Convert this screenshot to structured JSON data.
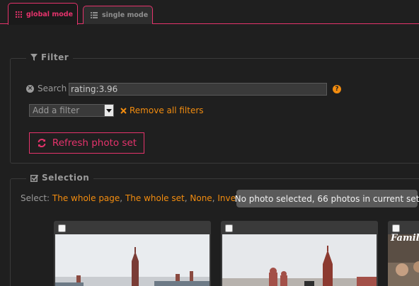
{
  "tabs": [
    {
      "label": "global mode",
      "icon": "grid-icon",
      "active": true
    },
    {
      "label": "single mode",
      "icon": "list-icon",
      "active": false
    }
  ],
  "filter": {
    "legend": "Filter",
    "search_label": "Search",
    "search_value": "rating:3.96",
    "select_value": "Add a filter",
    "remove_all_label": "Remove all filters",
    "refresh_label": "Refresh photo set"
  },
  "selection": {
    "legend": "Selection",
    "select_label": "Select:",
    "links": [
      "The whole page",
      "The whole set",
      "None",
      "Invert"
    ],
    "separator": ",",
    "status": "No photo selected, 66 photos in current set"
  },
  "photos": [
    {
      "caption": ""
    },
    {
      "caption": ""
    },
    {
      "caption": "Famil"
    }
  ],
  "colors": {
    "accent": "#e5336c",
    "link": "#f28c0f",
    "background": "#1f1f1f"
  }
}
